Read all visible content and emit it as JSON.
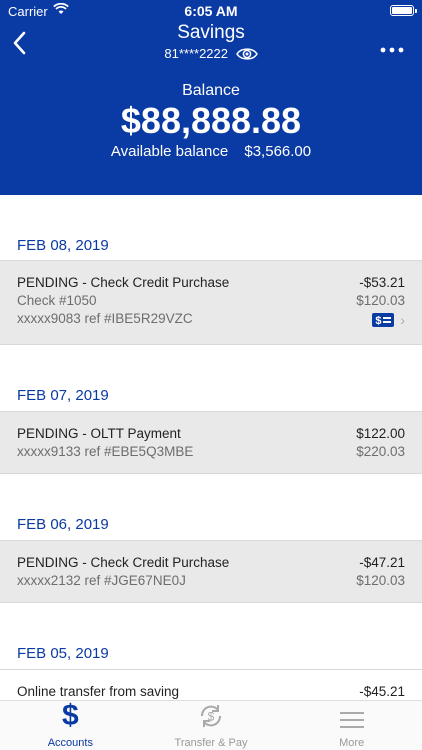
{
  "status_bar": {
    "carrier": "Carrier",
    "time": "6:05 AM"
  },
  "header": {
    "title": "Savings",
    "account_number": "81****2222",
    "balance_label": "Balance",
    "balance": "$88,888.88",
    "available_label": "Available balance",
    "available_amount": "$3,566.00",
    "bg_color": "#0a3aa3"
  },
  "groups": [
    {
      "date": "FEB 08, 2019",
      "transactions": [
        {
          "desc": "PENDING - Check Credit Purchase",
          "amount": "-$53.21",
          "sub1": "Check #1050",
          "balance": "$120.03",
          "ref": "xxxxx9083 ref #IBE5R29VZC",
          "icon": "check-image-icon"
        }
      ]
    },
    {
      "date": "FEB 07, 2019",
      "transactions": [
        {
          "desc": "PENDING - OLTT Payment",
          "amount": "$122.00",
          "ref": "xxxxx9133 ref #EBE5Q3MBE",
          "balance": "$220.03"
        }
      ]
    },
    {
      "date": "FEB 06, 2019",
      "transactions": [
        {
          "desc": "PENDING - Check Credit Purchase",
          "amount": "-$47.21",
          "ref": "xxxxx2132 ref #JGE67NE0J",
          "balance": "$120.03"
        }
      ]
    },
    {
      "date": "FEB 05, 2019",
      "transactions": [
        {
          "desc": "Online transfer from saving",
          "amount": "-$45.21"
        }
      ]
    }
  ],
  "tabbar": {
    "tabs": [
      {
        "label": "Accounts",
        "icon": "dollar-icon",
        "active": true
      },
      {
        "label": "Transfer & Pay",
        "icon": "transfer-icon",
        "active": false
      },
      {
        "label": "More",
        "icon": "menu-icon",
        "active": false
      }
    ],
    "accent": "#0a3aa3"
  }
}
